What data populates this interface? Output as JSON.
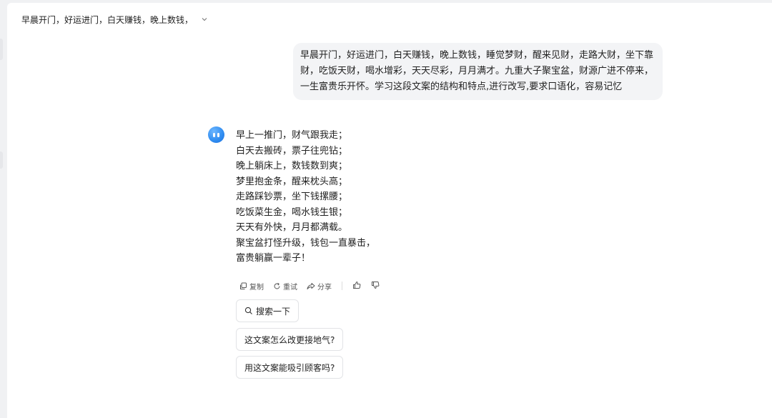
{
  "header": {
    "title": "早晨开门，好运进门，白天赚钱，晚上数钱，"
  },
  "user_message": "早晨开门，好运进门，白天赚钱，晚上数钱，睡觉梦财，醒来见财，走路大财，坐下靠财，吃饭天财，喝水增彩，天天尽彩，月月满才。九重大子聚宝盆，财源广进不停来，一生富贵乐开怀。学习这段文案的结构和特点,进行改写,要求口语化，容易记忆",
  "assistant_lines": [
    "早上一推门，财气跟我走；",
    "白天去搬砖，票子往兜钻；",
    "晚上躺床上，数钱数到爽；",
    "梦里抱金条，醒来枕头高；",
    "走路踩钞票，坐下钱摞腰；",
    "吃饭菜生金，喝水钱生银；",
    "天天有外快，月月都满载。",
    "聚宝盆打怪升级，钱包一直暴击，",
    "富贵躺赢一辈子！"
  ],
  "actions": {
    "copy": "复制",
    "retry": "重试",
    "share": "分享"
  },
  "suggestions": [
    "搜索一下",
    "这文案怎么改更接地气?",
    "用这文案能吸引顾客吗?"
  ],
  "colors": {
    "accent": "#2f8cf0",
    "bubble": "#f3f4f6",
    "background": "#f0f1f3"
  }
}
